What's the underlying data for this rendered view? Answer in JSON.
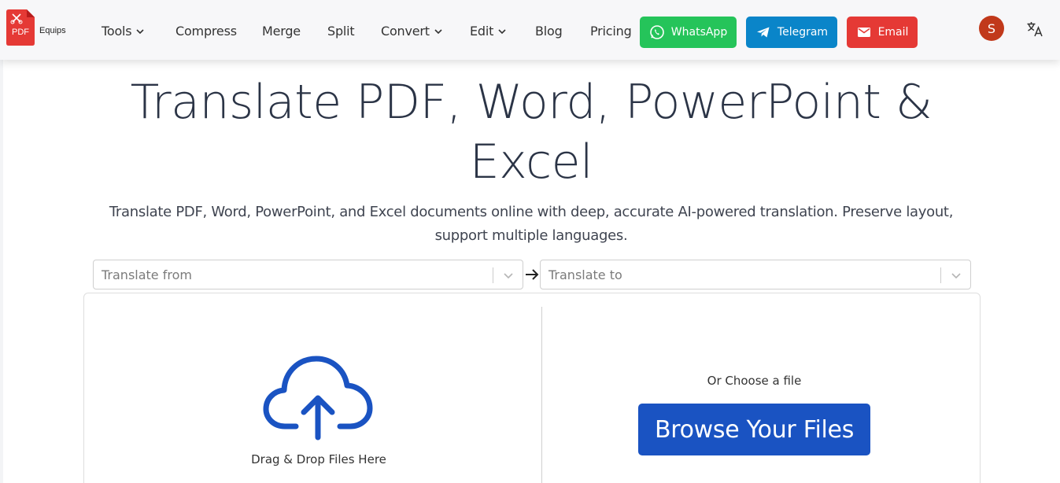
{
  "brand": {
    "name": "Equips",
    "doc_label": "PDF",
    "brand_color": "#e53935"
  },
  "nav": {
    "items": [
      {
        "label": "Tools",
        "has_dropdown": true
      },
      {
        "label": "Compress",
        "has_dropdown": false
      },
      {
        "label": "Merge",
        "has_dropdown": false
      },
      {
        "label": "Split",
        "has_dropdown": false
      },
      {
        "label": "Convert",
        "has_dropdown": true
      },
      {
        "label": "Edit",
        "has_dropdown": true
      },
      {
        "label": "Blog",
        "has_dropdown": false
      },
      {
        "label": "Pricing",
        "has_dropdown": false
      }
    ],
    "contact": {
      "whatsapp": {
        "label": "WhatsApp",
        "icon": "whatsapp-icon",
        "color": "#25c45a"
      },
      "telegram": {
        "label": "Telegram",
        "icon": "telegram-icon",
        "color": "#0a85c9"
      },
      "email": {
        "label": "Email",
        "icon": "mail-icon",
        "color": "#e53935"
      }
    },
    "avatar_initial": "S",
    "language_icon": "translate-icon"
  },
  "hero": {
    "title": "Translate PDF, Word, PowerPoint & Excel",
    "subtitle": "Translate PDF, Word, PowerPoint, and Excel documents online with deep, accurate AI-powered translation. Preserve layout, support multiple languages."
  },
  "translate": {
    "from_placeholder": "Translate from",
    "to_placeholder": "Translate to"
  },
  "upload": {
    "drag_text": "Drag & Drop Files Here",
    "choose_text": "Or Choose a file",
    "browse_label": "Browse Your Files",
    "accent_color": "#1a53c2"
  }
}
